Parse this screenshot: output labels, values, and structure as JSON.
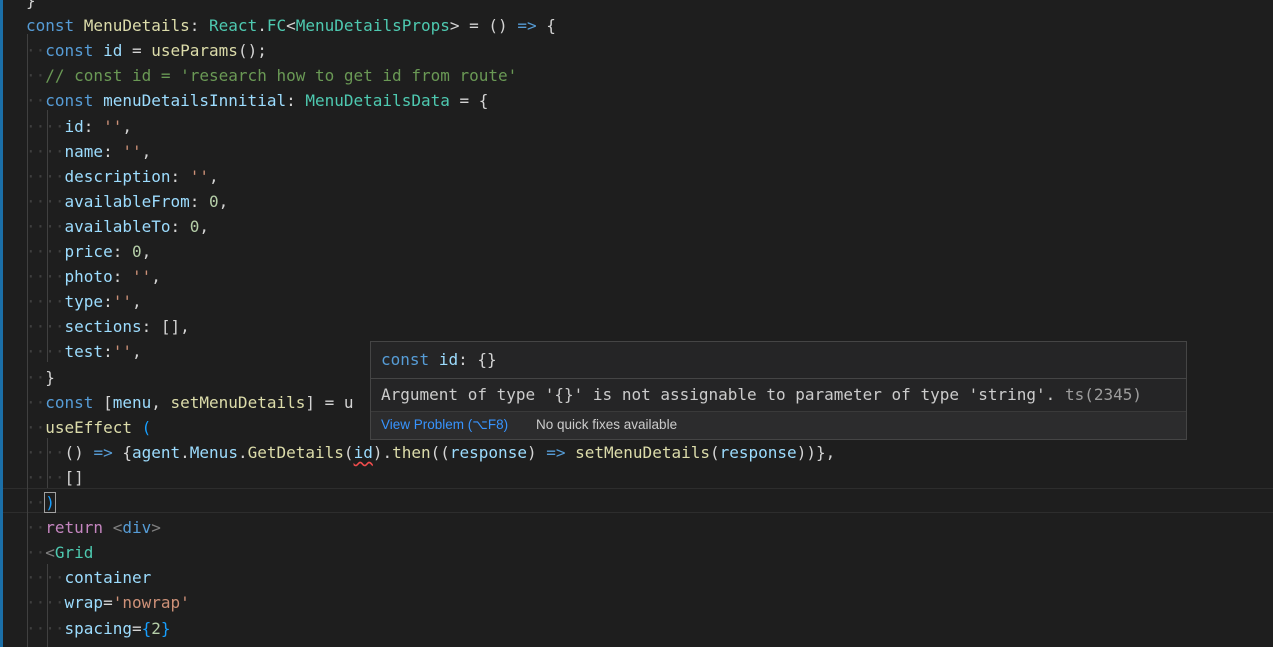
{
  "editor": {
    "lines": [
      {
        "segs": [
          [
            "pun",
            "}"
          ]
        ]
      },
      {
        "segs": [
          [
            "kw",
            "const "
          ],
          [
            "fn",
            "MenuDetails"
          ],
          [
            "pun",
            ": "
          ],
          [
            "typ",
            "React"
          ],
          [
            "pun",
            "."
          ],
          [
            "typ",
            "FC"
          ],
          [
            "pun",
            "<"
          ],
          [
            "typ",
            "MenuDetailsProps"
          ],
          [
            "pun",
            "> = "
          ],
          [
            "pun",
            "() "
          ],
          [
            "kw",
            "=>"
          ],
          [
            "pun",
            " {"
          ]
        ]
      },
      {
        "segs": [
          [
            "kw",
            "const "
          ],
          [
            "var",
            "id"
          ],
          [
            "pun",
            " = "
          ],
          [
            "fn",
            "useParams"
          ],
          [
            "pun",
            "();"
          ]
        ]
      },
      {
        "segs": [
          [
            "cmt",
            "// const id = 'research how to get id from route'"
          ]
        ]
      },
      {
        "segs": [
          [
            "kw",
            "const "
          ],
          [
            "var",
            "menuDetailsInnitial"
          ],
          [
            "pun",
            ": "
          ],
          [
            "typ",
            "MenuDetailsData"
          ],
          [
            "pun",
            " = {"
          ]
        ]
      },
      {
        "segs": [
          [
            "var",
            "id"
          ],
          [
            "pun",
            ": "
          ],
          [
            "str",
            "''"
          ],
          [
            "pun",
            ","
          ]
        ]
      },
      {
        "segs": [
          [
            "var",
            "name"
          ],
          [
            "pun",
            ": "
          ],
          [
            "str",
            "''"
          ],
          [
            "pun",
            ","
          ]
        ]
      },
      {
        "segs": [
          [
            "var",
            "description"
          ],
          [
            "pun",
            ": "
          ],
          [
            "str",
            "''"
          ],
          [
            "pun",
            ","
          ]
        ]
      },
      {
        "segs": [
          [
            "var",
            "availableFrom"
          ],
          [
            "pun",
            ": "
          ],
          [
            "num",
            "0"
          ],
          [
            "pun",
            ","
          ]
        ]
      },
      {
        "segs": [
          [
            "var",
            "availableTo"
          ],
          [
            "pun",
            ": "
          ],
          [
            "num",
            "0"
          ],
          [
            "pun",
            ","
          ]
        ]
      },
      {
        "segs": [
          [
            "var",
            "price"
          ],
          [
            "pun",
            ": "
          ],
          [
            "num",
            "0"
          ],
          [
            "pun",
            ","
          ]
        ]
      },
      {
        "segs": [
          [
            "var",
            "photo"
          ],
          [
            "pun",
            ": "
          ],
          [
            "str",
            "''"
          ],
          [
            "pun",
            ","
          ]
        ]
      },
      {
        "segs": [
          [
            "var",
            "type"
          ],
          [
            "pun",
            ":"
          ],
          [
            "str",
            "''"
          ],
          [
            "pun",
            ","
          ]
        ]
      },
      {
        "segs": [
          [
            "var",
            "sections"
          ],
          [
            "pun",
            ": [],"
          ]
        ]
      },
      {
        "segs": [
          [
            "var",
            "test"
          ],
          [
            "pun",
            ":"
          ],
          [
            "str",
            "''"
          ],
          [
            "pun",
            ","
          ]
        ]
      },
      {
        "segs": [
          [
            "pun",
            "}"
          ]
        ]
      },
      {
        "segs": [
          [
            "kw",
            "const "
          ],
          [
            "pun",
            "["
          ],
          [
            "var",
            "menu"
          ],
          [
            "pun",
            ", "
          ],
          [
            "fn",
            "setMenuDetails"
          ],
          [
            "pun",
            "] = u"
          ]
        ]
      },
      {
        "segs": [
          [
            "fn",
            "useEffect"
          ],
          [
            "pun",
            " "
          ],
          [
            "br",
            "("
          ]
        ]
      },
      {
        "segs": [
          [
            "pun",
            "() "
          ],
          [
            "kw",
            "=>"
          ],
          [
            "pun",
            " {"
          ],
          [
            "var",
            "agent"
          ],
          [
            "pun",
            "."
          ],
          [
            "var",
            "Menus"
          ],
          [
            "pun",
            "."
          ],
          [
            "fn",
            "GetDetails"
          ],
          [
            "pun",
            "("
          ],
          [
            "var squiggle",
            "id"
          ],
          [
            "pun",
            ")."
          ],
          [
            "fn",
            "then"
          ],
          [
            "pun",
            "(("
          ],
          [
            "var",
            "response"
          ],
          [
            "pun",
            ") "
          ],
          [
            "kw",
            "=>"
          ],
          [
            "pun",
            " "
          ],
          [
            "fn",
            "setMenuDetails"
          ],
          [
            "pun",
            "("
          ],
          [
            "var",
            "response"
          ],
          [
            "pun",
            "))},"
          ]
        ]
      },
      {
        "segs": [
          [
            "pun",
            "[]"
          ]
        ]
      },
      {
        "segs": [
          [
            "br cursor-box",
            ")"
          ]
        ]
      },
      {
        "segs": [
          [
            "ctl",
            "return"
          ],
          [
            "pun",
            " "
          ],
          [
            "tag",
            "<"
          ],
          [
            "kw",
            "div"
          ],
          [
            "tag",
            ">"
          ]
        ]
      },
      {
        "segs": [
          [
            "tag",
            "<"
          ],
          [
            "typ",
            "Grid"
          ]
        ]
      },
      {
        "segs": [
          [
            "var",
            "container"
          ]
        ]
      },
      {
        "segs": [
          [
            "var",
            "wrap"
          ],
          [
            "pun",
            "="
          ],
          [
            "str",
            "'nowrap'"
          ]
        ]
      },
      {
        "segs": [
          [
            "var",
            "spacing"
          ],
          [
            "pun",
            "="
          ],
          [
            "br",
            "{"
          ],
          [
            "num",
            "2"
          ],
          [
            "br",
            "}"
          ]
        ]
      }
    ]
  },
  "hover": {
    "sig_kw": "const",
    "sig_name": "id",
    "sig_type": ": {}",
    "message": "Argument of type '{}' is not assignable to parameter of type 'string'.",
    "code": "ts(2345)",
    "view_problem": "View Problem (⌥F8)",
    "no_fixes": "No quick fixes available"
  },
  "colors": {
    "background": "#1e1e1e",
    "accent_bar": "#1b6fa8",
    "link": "#3794ff",
    "error": "#f14c4c"
  }
}
